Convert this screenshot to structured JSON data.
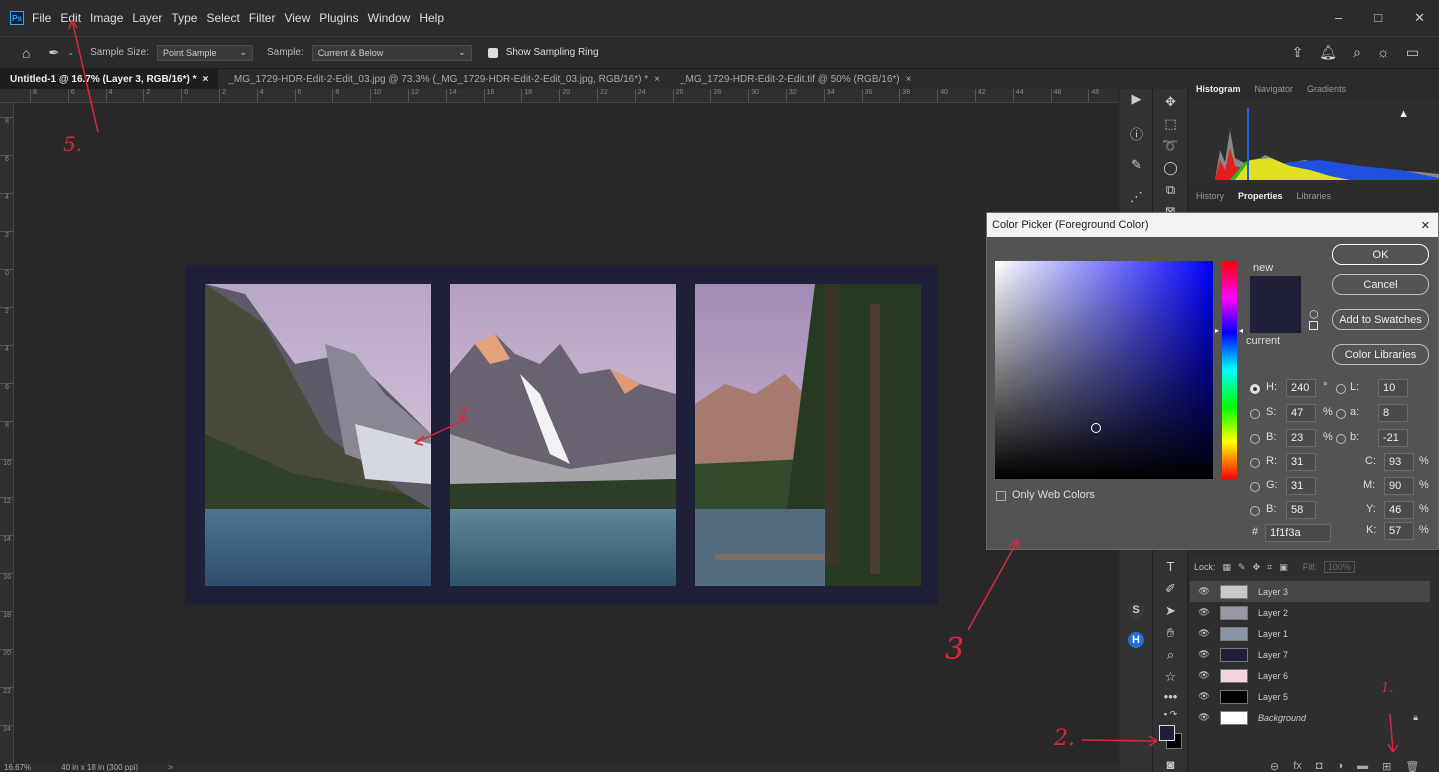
{
  "menu": [
    "File",
    "Edit",
    "Image",
    "Layer",
    "Type",
    "Select",
    "Filter",
    "View",
    "Plugins",
    "Window",
    "Help"
  ],
  "window_controls": {
    "minimize": "–",
    "maximize": "□",
    "close": "✕"
  },
  "options": {
    "sample_size_label": "Sample Size:",
    "sample_size_value": "Point Sample",
    "sample_label": "Sample:",
    "sample_value": "Current & Below",
    "show_ring_label": "Show Sampling Ring"
  },
  "tabs": [
    "Untitled-1 @ 16.7% (Layer 3, RGB/16*) *",
    "_MG_1729-HDR-Edit-2-Edit_03.jpg @ 73.3% (_MG_1729-HDR-Edit-2-Edit_03.jpg, RGB/16*) *",
    "_MG_1729-HDR-Edit-2-Edit.tif @ 50% (RGB/16*)"
  ],
  "tab_close": "×",
  "ruler_h": [
    "8",
    "6",
    "4",
    "2",
    "0",
    "2",
    "4",
    "6",
    "8",
    "10",
    "12",
    "14",
    "16",
    "18",
    "20",
    "22",
    "24",
    "26",
    "28",
    "30",
    "32",
    "34",
    "36",
    "38",
    "40",
    "42",
    "44",
    "46",
    "48"
  ],
  "ruler_v": [
    "8",
    "6",
    "4",
    "2",
    "0",
    "2",
    "4",
    "6",
    "8",
    "10",
    "12",
    "14",
    "16",
    "18",
    "20",
    "22",
    "24"
  ],
  "status": {
    "zoom": "16.67%",
    "size": "40 in x 18 in (300 ppi)",
    "arrow": ">"
  },
  "panels": {
    "top_tabs": [
      "Histogram",
      "Navigator",
      "Gradients"
    ],
    "mid_tabs": [
      "History",
      "Properties",
      "Libraries"
    ],
    "warning": "▲"
  },
  "dialog": {
    "title": "Color Picker (Foreground Color)",
    "close": "✕",
    "new_label": "new",
    "current_label": "current",
    "buttons": {
      "ok": "OK",
      "cancel": "Cancel",
      "add": "Add to Swatches",
      "libraries": "Color Libraries"
    },
    "only_web": "Only Web Colors",
    "fields": {
      "H": {
        "label": "H:",
        "value": "240",
        "unit": "°"
      },
      "S": {
        "label": "S:",
        "value": "47",
        "unit": "%"
      },
      "B": {
        "label": "B:",
        "value": "23",
        "unit": "%"
      },
      "R": {
        "label": "R:",
        "value": "31"
      },
      "G": {
        "label": "G:",
        "value": "31"
      },
      "B2": {
        "label": "B:",
        "value": "58"
      },
      "L": {
        "label": "L:",
        "value": "10"
      },
      "a": {
        "label": "a:",
        "value": "8"
      },
      "b": {
        "label": "b:",
        "value": "-21"
      },
      "C": {
        "label": "C:",
        "value": "93",
        "unit": "%"
      },
      "M": {
        "label": "M:",
        "value": "90",
        "unit": "%"
      },
      "Y": {
        "label": "Y:",
        "value": "46",
        "unit": "%"
      },
      "K": {
        "label": "K:",
        "value": "57",
        "unit": "%"
      },
      "hex": {
        "label": "#",
        "value": "1f1f3a"
      }
    },
    "new_color": "#1f1f3a",
    "current_color": "#1f1f3a"
  },
  "layers_panel": {
    "lock_label": "Lock:",
    "fill_label": "Fill:",
    "fill_value": "100%",
    "layers": [
      {
        "name": "Layer 3",
        "color": "#c9c9c9",
        "selected": true
      },
      {
        "name": "Layer 2",
        "color": "#9a96a8",
        "selected": false
      },
      {
        "name": "Layer 1",
        "color": "#8a94a8",
        "selected": false
      },
      {
        "name": "Layer 7",
        "color": "#1f1f3a",
        "selected": false
      },
      {
        "name": "Layer 6",
        "color": "#f3d3dc",
        "selected": false
      },
      {
        "name": "Layer 5",
        "color": "#000000",
        "selected": false
      },
      {
        "name": "Background",
        "color": "#ffffff",
        "selected": false
      }
    ]
  },
  "annotations": {
    "a1": "1.",
    "a2": "2.",
    "a3": "3",
    "a4": "4",
    "a5": "5."
  },
  "colors": {
    "accent": "#31a8ff",
    "annotation": "#d8283a",
    "document_bg": "#1f1f3a"
  }
}
